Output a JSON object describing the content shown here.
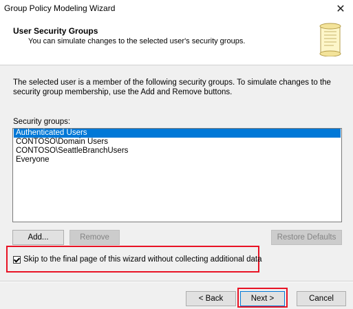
{
  "window": {
    "title": "Group Policy Modeling Wizard",
    "close_glyph": "✕"
  },
  "header": {
    "title": "User Security Groups",
    "subtitle": "You can simulate changes to the selected user's security groups.",
    "icon": "scroll-icon"
  },
  "intro_text": "The selected user is a member of the following security groups. To simulate changes to the security group membership, use the Add and Remove buttons.",
  "security_groups": {
    "label": "Security groups:",
    "items": [
      "Authenticated Users",
      "CONTOSO\\Domain Users",
      "CONTOSO\\SeattleBranchUsers",
      "Everyone"
    ],
    "selected_index": 0
  },
  "buttons": {
    "add": "Add...",
    "remove": "Remove",
    "restore": "Restore Defaults",
    "back": "< Back",
    "next": "Next >",
    "cancel": "Cancel"
  },
  "skip_checkbox": {
    "label": "Skip to the final page of this wizard without collecting additional data",
    "checked": true
  },
  "colors": {
    "selection": "#0078d7",
    "highlight": "#e81123"
  }
}
